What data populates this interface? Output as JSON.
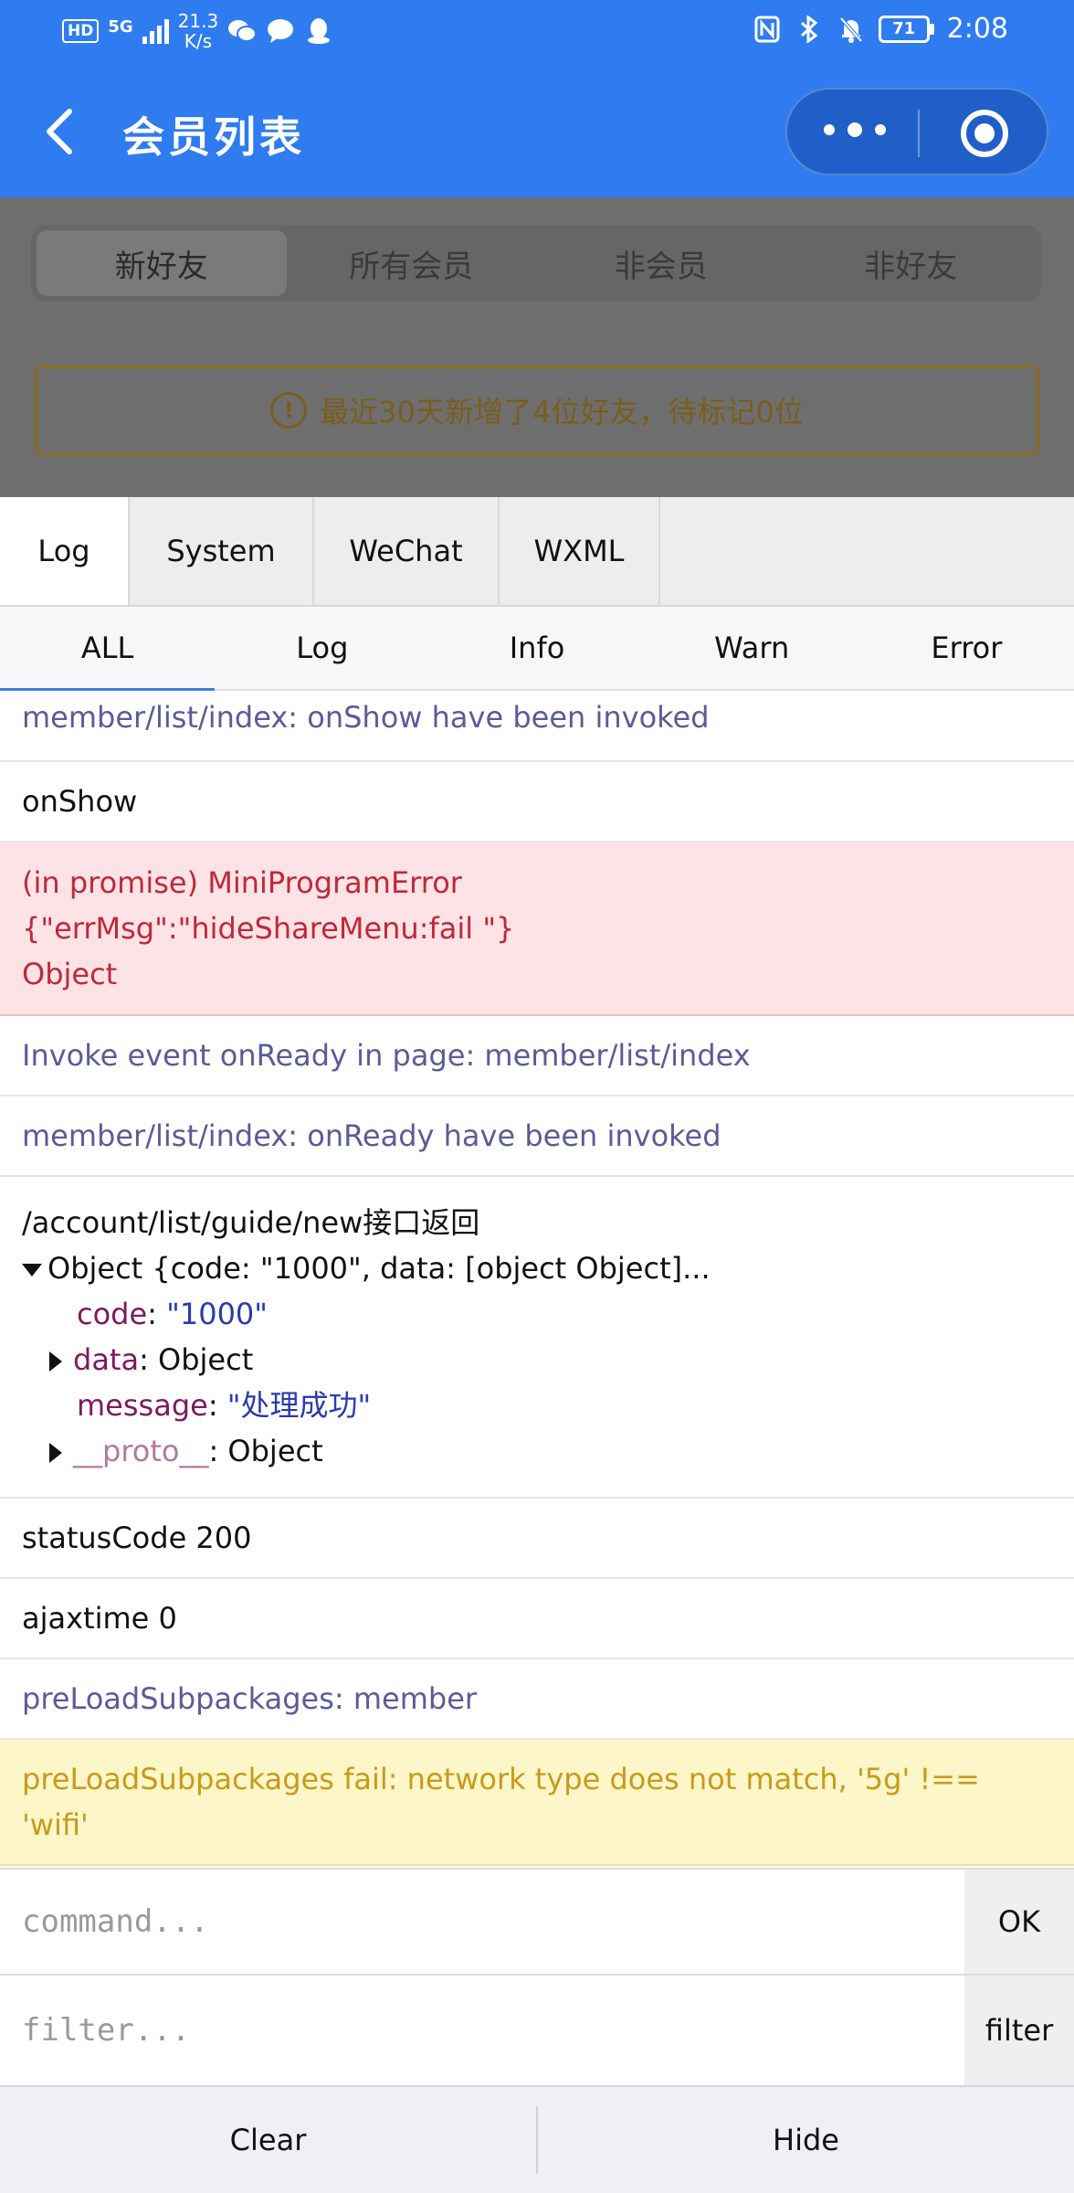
{
  "status_bar": {
    "hd": "HD",
    "network": "5G",
    "speed_value": "21.3",
    "speed_unit": "K/s",
    "battery": "71",
    "time": "2:08"
  },
  "nav": {
    "title": "会员列表"
  },
  "page": {
    "segments": [
      "新好友",
      "所有会员",
      "非会员",
      "非好友"
    ],
    "active_segment": 0,
    "notice": "最近30天新增了4位好友，待标记0位"
  },
  "console": {
    "tabs": [
      "Log",
      "System",
      "WeChat",
      "WXML"
    ],
    "active_tab": 0,
    "subtabs": [
      "ALL",
      "Log",
      "Info",
      "Warn",
      "Error"
    ],
    "active_subtab": 0,
    "logs": {
      "l1": "member/list/index: onShow have been invoked",
      "l2": "onShow",
      "l3a": "(in promise) MiniProgramError",
      "l3b": "{\"errMsg\":\"hideShareMenu:fail \"}",
      "l3c": "Object",
      "l4": "Invoke event onReady in page: member/list/index",
      "l5": "member/list/index: onReady have been invoked",
      "l6_url": "/account/list/guide/new接口返回",
      "l6_obj": "Object {code: \"1000\", data: [object Object]...",
      "l6_code_key": "code",
      "l6_code_val": "\"1000\"",
      "l6_data_key": "data",
      "l6_data_val": "Object",
      "l6_msg_key": "message",
      "l6_msg_val": "\"处理成功\"",
      "l6_proto_key": "__proto__",
      "l6_proto_val": "Object",
      "l7": "statusCode 200",
      "l8": "ajaxtime 0",
      "l9": "preLoadSubpackages: member",
      "l10a": "preLoadSubpackages fail: network type does not match, '5g' !==",
      "l10b": "'wifi'"
    },
    "command_placeholder": "command...",
    "ok_label": "OK",
    "filter_placeholder": "filter...",
    "filter_label": "filter",
    "clear_label": "Clear",
    "hide_label": "Hide"
  }
}
